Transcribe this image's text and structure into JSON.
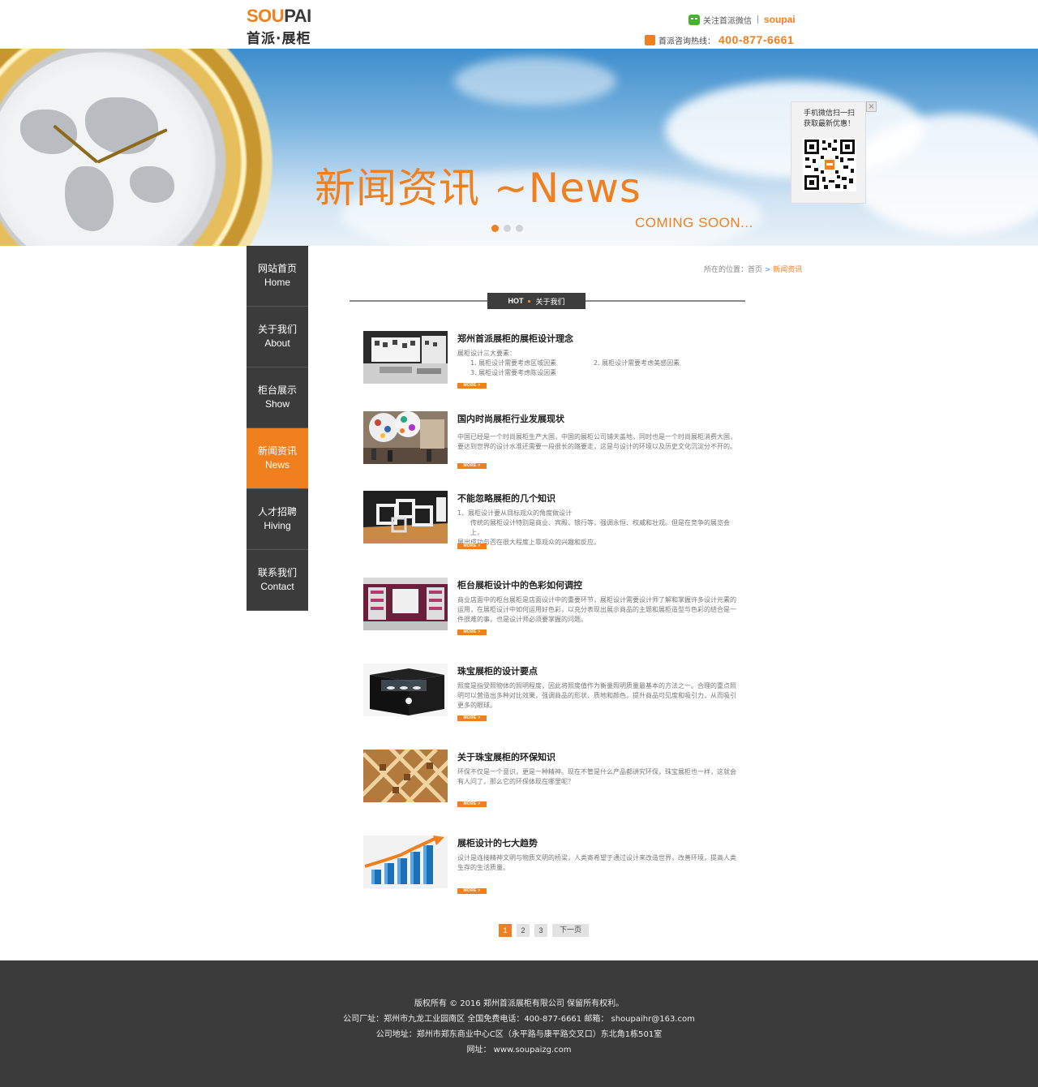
{
  "header": {
    "logo_en_orange": "SOU",
    "logo_en_dark": "PAI",
    "logo_cn": "首派·展柜",
    "wechat_text": "关注首派微信",
    "wechat_brand": "soupai",
    "hotline_label": "首派咨询热线：",
    "hotline_number": "400-877-6661",
    "accent_color": "#f07f1d"
  },
  "banner": {
    "title": "新闻资讯 ~News",
    "subtitle": "COMING SOON...",
    "qr_text_1": "手机微信扫一扫",
    "qr_text_2": "获取最新优惠！",
    "qr_close": "×",
    "slides": 3,
    "active_slide": 1
  },
  "sidenav": {
    "items": [
      {
        "cn": "网站首页",
        "en": "Home"
      },
      {
        "cn": "关于我们",
        "en": "About"
      },
      {
        "cn": "柜台展示",
        "en": "Show"
      },
      {
        "cn": "新闻资讯",
        "en": "News"
      },
      {
        "cn": "人才招聘",
        "en": "Hiving"
      },
      {
        "cn": "联系我们",
        "en": "Contact"
      }
    ],
    "active_index": 3
  },
  "breadcrumb": {
    "prefix": "所在的位置：首页 >",
    "current": "新闻资讯"
  },
  "section": {
    "hot": "HOT",
    "label": "关于我们"
  },
  "news": {
    "more_label": "MORE >",
    "items": [
      {
        "title": "郑州首派展柜的展柜设计理念",
        "desc_intro": "展柜设计三大要素：",
        "desc_point_1": "1. 展柜设计需要考虑区域因素",
        "desc_point_2": "2. 展柜设计需要考虑美感因素",
        "desc_point_3": "3. 展柜设计需要考虑陈设因素"
      },
      {
        "title": "国内时尚展柜行业发展现状",
        "desc_1": "中国已经是一个时尚展柜生产大国，中国的展柜公司铺天盖地，同时也是一个时尚展柜消费大国，",
        "desc_2": "要达到世界的设计水准还需要一段很长的路要走，这是与设计的环境以及历史文化沉淀分不开的。"
      },
      {
        "title": "不能忽略展柜的几个知识",
        "desc_1": "1、展柜设计要从目标观众的角度做设计",
        "desc_2": "传统的展柜设计特别是商业、宾殿、银行等，强调永恒、权威和壮观。但是在竞争的展览会上，",
        "desc_3": "展出成功与否在很大程度上靠观众的兴趣和反应。"
      },
      {
        "title": "柜台展柜设计中的色彩如何调控",
        "desc_1": "商业店面中的柜台展柜是店面设计中的重要环节，展柜设计需要设计师了解和掌握许多设计元素的",
        "desc_2": "运用，在展柜设计中如何运用好色彩，以充分表现出展示商品的主题和展柜造型与色彩的结合是一",
        "desc_3": "件很难的事，也是设计师必须要掌握的问题。"
      },
      {
        "title": "珠宝展柜的设计要点",
        "desc_1": "照度是指受照物体的照明程度，因此将照度值作为衡量照明质量最基本的方法之一。合理的重点照",
        "desc_2": "明可以营造出多种对比效果，强调商品的形状、质地和颜色，提升商品可见度和吸引力，从而吸引",
        "desc_3": "更多的眼球。"
      },
      {
        "title": "关于珠宝展柜的环保知识",
        "desc_1": "环保不仅是一个意识，更是一种精神。现在不管是什么产品都讲究环保，珠宝展柜也一样，这就会",
        "desc_2": "有人问了，那么它的环保体现在哪里呢？"
      },
      {
        "title": "展柜设计的七大趋势",
        "desc_1": "设计是连接精神文明与物质文明的桥梁，人类寄希望于通过设计来改造世界，改善环境，提高人类",
        "desc_2": "生存的生活质量。"
      }
    ]
  },
  "pager": {
    "pages": [
      "1",
      "2",
      "3"
    ],
    "active": "1",
    "next_label": "下一页"
  },
  "footer": {
    "line_1": "版权所有 © 2016 郑州首派展柜有限公司 保留所有权利。",
    "line_2": "公司厂址：郑州市九龙工业园南区 全国免费电话：400-877-6661  邮箱： shoupaihr@163.com",
    "line_3": "公司地址：郑州市郑东商业中心C区（永平路与康平路交叉口）东北角1栋501室",
    "line_4": "网址： www.soupaizg.com"
  }
}
